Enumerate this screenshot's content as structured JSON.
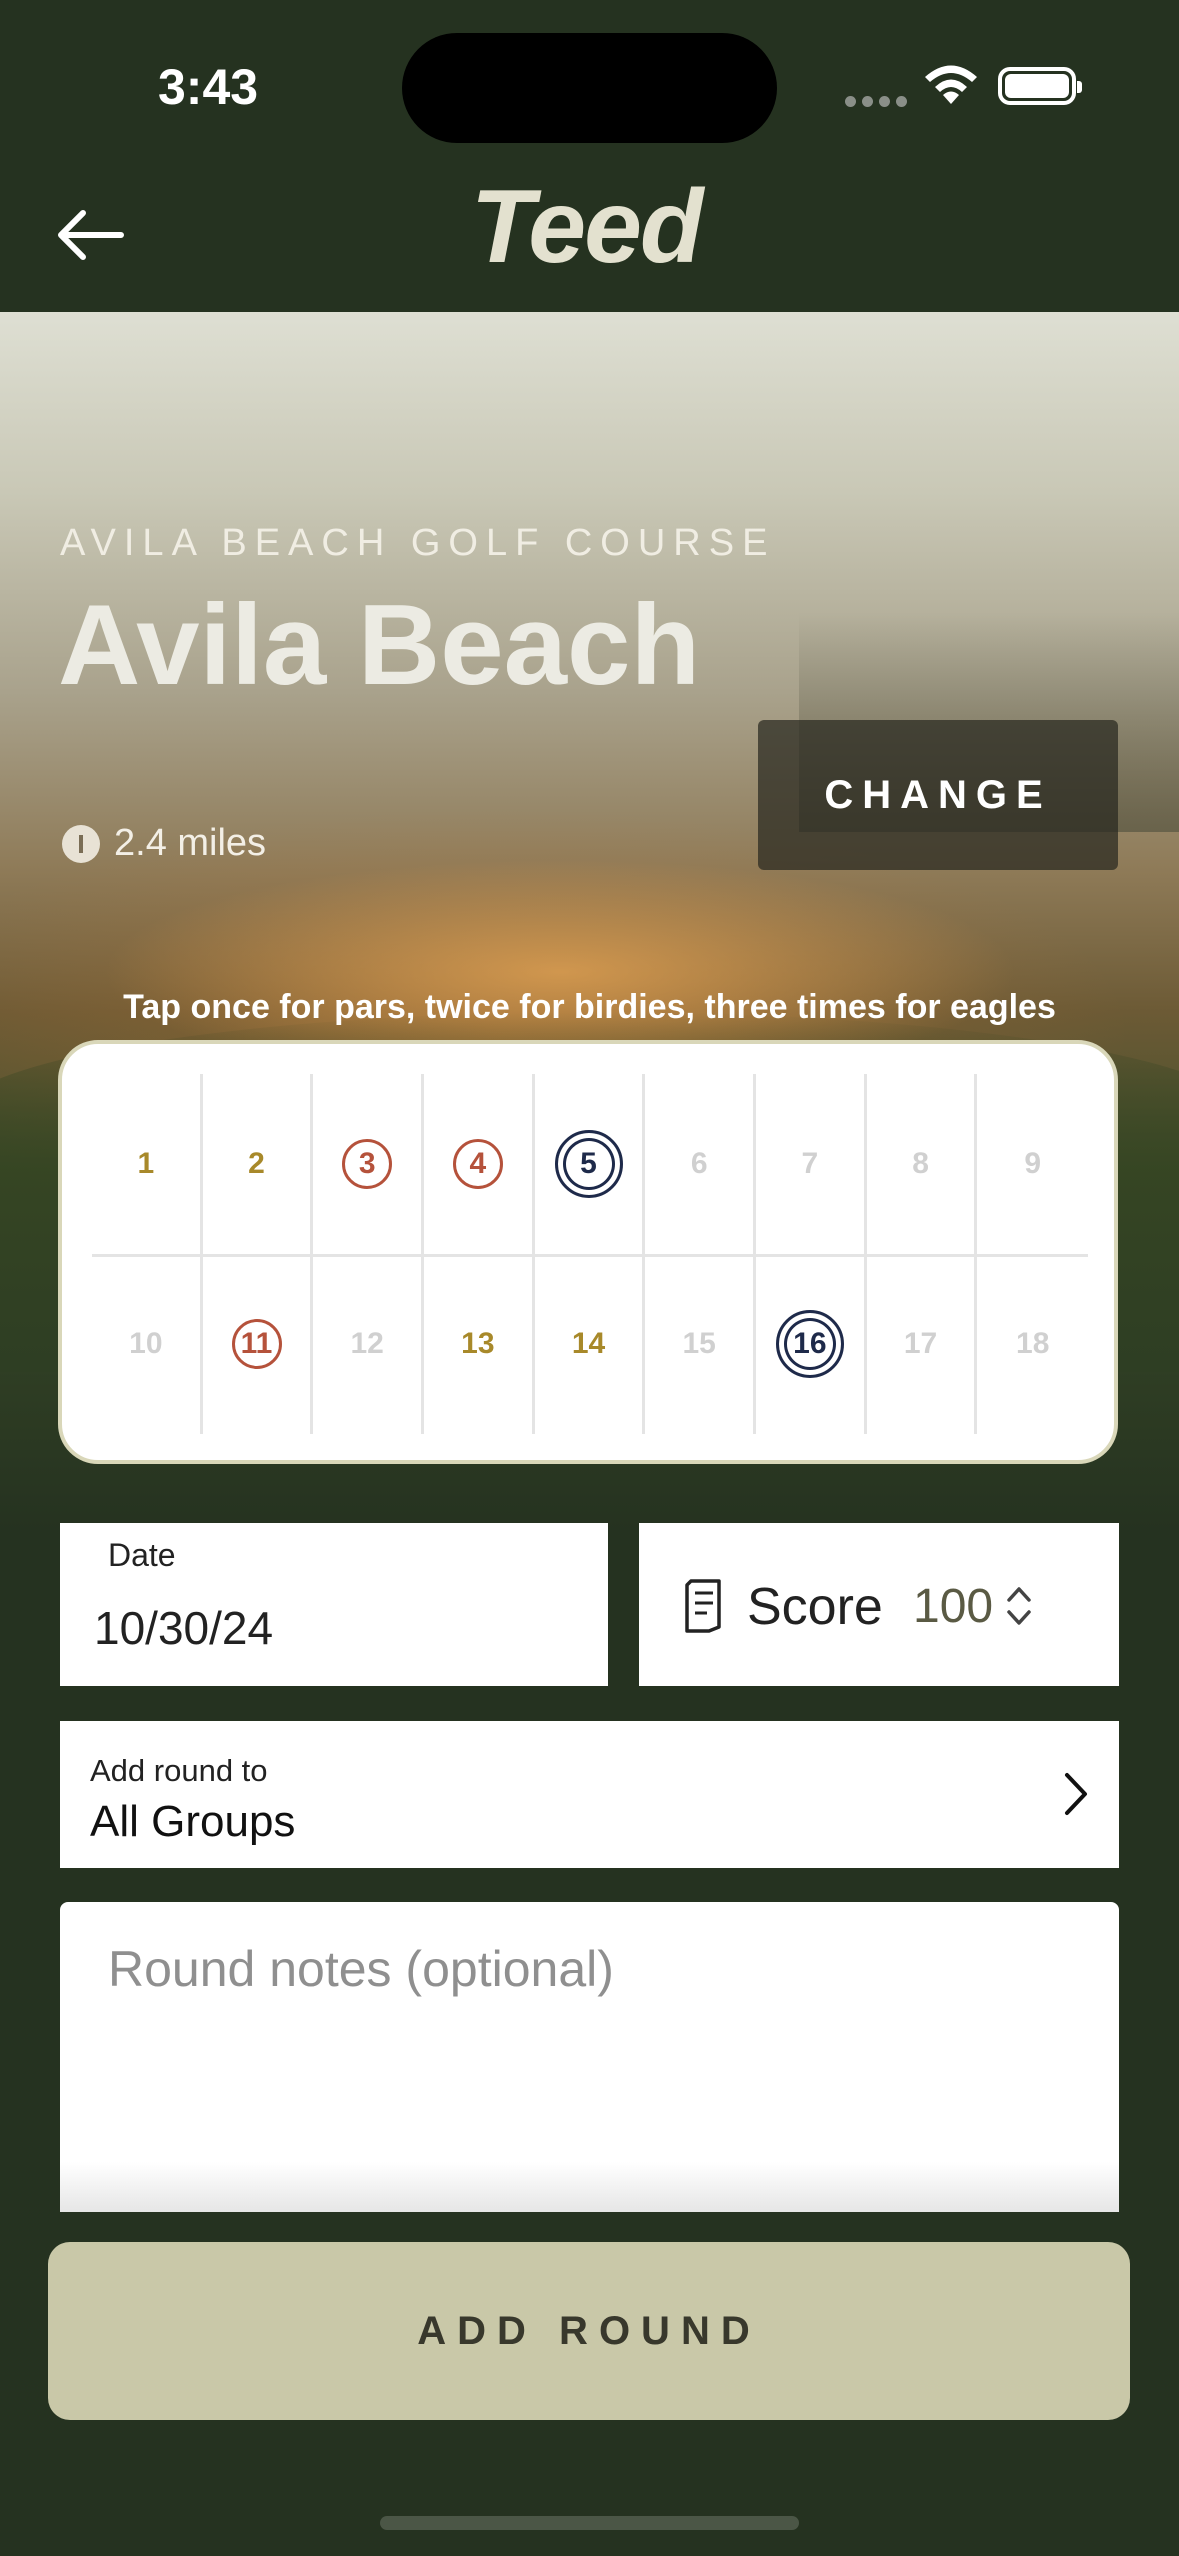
{
  "status_bar": {
    "time": "3:43"
  },
  "nav": {
    "logo": "Teed"
  },
  "course": {
    "club": "AVILA BEACH GOLF COURSE",
    "name": "Avila Beach",
    "distance": "2.4 miles",
    "change_label": "CHANGE"
  },
  "hint": "Tap once for pars, twice for birdies, three times for eagles",
  "scorecard": {
    "row1": [
      {
        "hole": "1",
        "result": "par"
      },
      {
        "hole": "2",
        "result": "par"
      },
      {
        "hole": "3",
        "result": "birdie"
      },
      {
        "hole": "4",
        "result": "birdie"
      },
      {
        "hole": "5",
        "result": "eagle"
      },
      {
        "hole": "6",
        "result": "none"
      },
      {
        "hole": "7",
        "result": "none"
      },
      {
        "hole": "8",
        "result": "none"
      },
      {
        "hole": "9",
        "result": "none"
      }
    ],
    "row2": [
      {
        "hole": "10",
        "result": "none"
      },
      {
        "hole": "11",
        "result": "birdie"
      },
      {
        "hole": "12",
        "result": "none"
      },
      {
        "hole": "13",
        "result": "par"
      },
      {
        "hole": "14",
        "result": "par"
      },
      {
        "hole": "15",
        "result": "none"
      },
      {
        "hole": "16",
        "result": "eagle"
      },
      {
        "hole": "17",
        "result": "none"
      },
      {
        "hole": "18",
        "result": "none"
      }
    ]
  },
  "date": {
    "label": "Date",
    "value": "10/30/24"
  },
  "score": {
    "label": "Score",
    "value": "100"
  },
  "group": {
    "label": "Add round to",
    "value": "All Groups"
  },
  "notes": {
    "placeholder": "Round notes (optional)"
  },
  "add_button": "ADD ROUND",
  "colors": {
    "background": "#253220",
    "par": "#a8892a",
    "birdie": "#b5523b",
    "eagle": "#1e2a4a",
    "button": "#c9c8a8"
  }
}
